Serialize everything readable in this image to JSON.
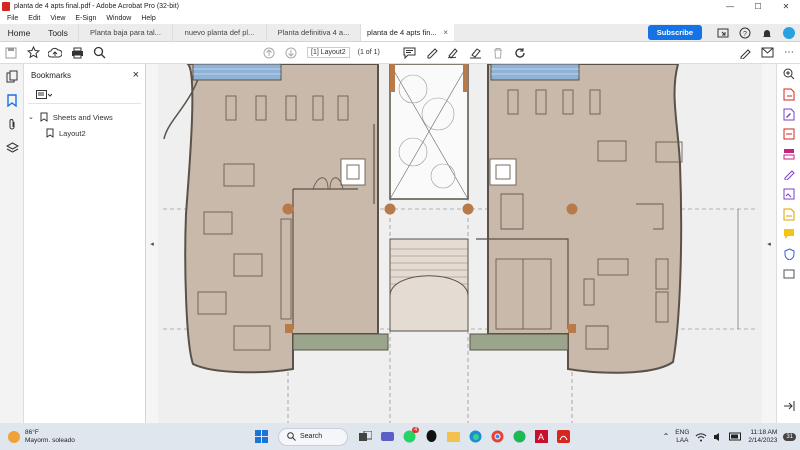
{
  "window": {
    "title": "planta de 4 apts final.pdf - Adobe Acrobat Pro (32-bit)"
  },
  "menu": [
    "File",
    "Edit",
    "View",
    "E-Sign",
    "Window",
    "Help"
  ],
  "tabs": {
    "home": "Home",
    "tools": "Tools",
    "documents": [
      "Planta baja para tal...",
      "nuevo planta def pl...",
      "Planta definitiva 4 a...",
      "planta de 4 apts fin..."
    ],
    "close_symbol": "×"
  },
  "header": {
    "subscribe": "Subscribe"
  },
  "toolbar": {
    "page_label": "[1] Layout2",
    "page_count": "(1 of 1)"
  },
  "bookmarks": {
    "title": "Bookmarks",
    "close_symbol": "×",
    "items": [
      {
        "label": "Sheets and Views"
      },
      {
        "label": "Layout2"
      }
    ]
  },
  "taskbar": {
    "temperature": "86°F",
    "weather_text": "Mayorm. soleado",
    "search": "Search",
    "badge": "4",
    "lang_line1": "ENG",
    "lang_line2": "LAA",
    "time": "11:18 AM",
    "date": "2/14/2023",
    "notification_count": "31"
  },
  "colors": {
    "accent": "#1473e6",
    "floor": "#c9b9ab",
    "wall": "#5a5248",
    "column": "#b87a48",
    "pdf_red": "#d7261e"
  }
}
